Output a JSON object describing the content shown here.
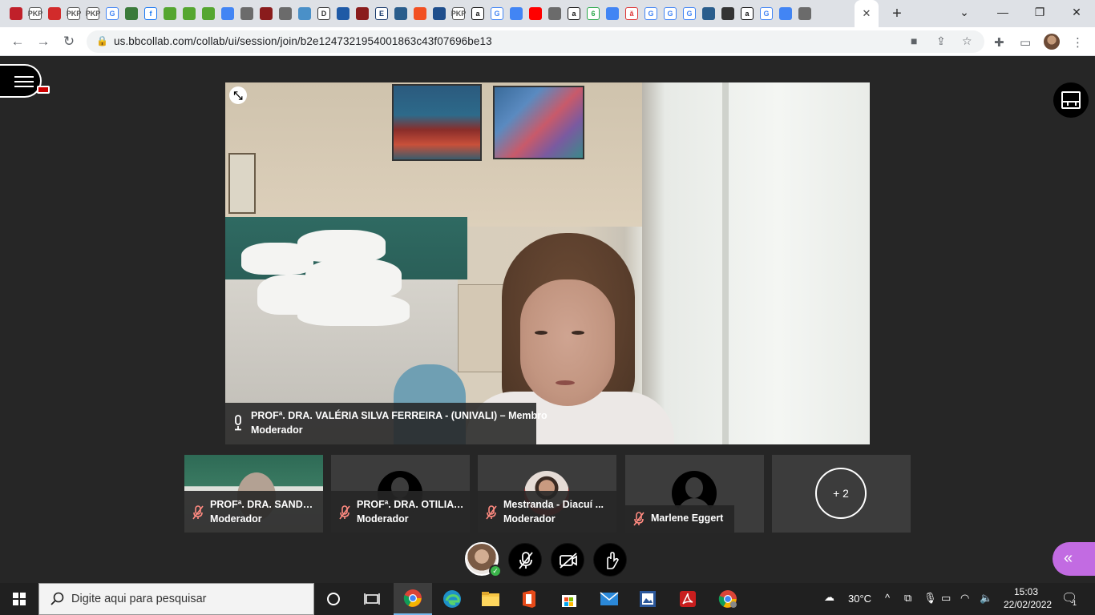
{
  "browser": {
    "url": "us.bbcollab.com/collab/ui/session/join/b2e1247321954001863c43f07696be13",
    "tab_icons": [
      {
        "name": "tab-icon-red-circle",
        "label": "",
        "color": "#c0202a"
      },
      {
        "name": "tab-icon-pkp",
        "label": "PKP",
        "color": "#555555"
      },
      {
        "name": "tab-icon-red-square",
        "label": "",
        "color": "#d22b2b"
      },
      {
        "name": "tab-icon-pkp",
        "label": "PKP",
        "color": "#555555"
      },
      {
        "name": "tab-icon-pkp",
        "label": "PKP",
        "color": "#555555"
      },
      {
        "name": "tab-icon-google",
        "label": "G",
        "color": "#4285f4"
      },
      {
        "name": "tab-icon-green-leaf",
        "label": "",
        "color": "#3a7a3a"
      },
      {
        "name": "tab-icon-facebook",
        "label": "f",
        "color": "#1877f2"
      },
      {
        "name": "tab-icon-search-green",
        "label": "",
        "color": "#55a630"
      },
      {
        "name": "tab-icon-search-green",
        "label": "",
        "color": "#55a630"
      },
      {
        "name": "tab-icon-search-green",
        "label": "",
        "color": "#55a630"
      },
      {
        "name": "tab-icon-docs",
        "label": "",
        "color": "#4285f4"
      },
      {
        "name": "tab-icon-globe",
        "label": "",
        "color": "#6b6b6b"
      },
      {
        "name": "tab-icon-pen",
        "label": "",
        "color": "#8a1c1c"
      },
      {
        "name": "tab-icon-globe",
        "label": "",
        "color": "#6b6b6b"
      },
      {
        "name": "tab-icon-asterisk",
        "label": "",
        "color": "#4a90c8"
      },
      {
        "name": "tab-icon-d",
        "label": "D",
        "color": "#333333"
      },
      {
        "name": "tab-icon-blue-mail",
        "label": "",
        "color": "#1f5aa6"
      },
      {
        "name": "tab-icon-pen",
        "label": "",
        "color": "#8a1c1c"
      },
      {
        "name": "tab-icon-e",
        "label": "E",
        "color": "#1a3a6b"
      },
      {
        "name": "tab-icon-camera",
        "label": "",
        "color": "#2a5d8c"
      },
      {
        "name": "tab-icon-microsoft",
        "label": "",
        "color": "#f25022"
      },
      {
        "name": "tab-icon-x-blue",
        "label": "",
        "color": "#1f4e8c"
      },
      {
        "name": "tab-icon-pkp",
        "label": "PKP",
        "color": "#555555"
      },
      {
        "name": "tab-icon-amazon",
        "label": "a",
        "color": "#111111"
      },
      {
        "name": "tab-icon-google",
        "label": "G",
        "color": "#4285f4"
      },
      {
        "name": "tab-icon-docs",
        "label": "",
        "color": "#4285f4"
      },
      {
        "name": "tab-icon-youtube",
        "label": "",
        "color": "#ff0000"
      },
      {
        "name": "tab-icon-globe",
        "label": "",
        "color": "#6b6b6b"
      },
      {
        "name": "tab-icon-amazon",
        "label": "a",
        "color": "#111111"
      },
      {
        "name": "tab-icon-six",
        "label": "6",
        "color": "#2aa84a"
      },
      {
        "name": "tab-icon-docs",
        "label": "",
        "color": "#4285f4"
      },
      {
        "name": "tab-icon-a-red",
        "label": "ă",
        "color": "#d33"
      },
      {
        "name": "tab-icon-google",
        "label": "G",
        "color": "#4285f4"
      },
      {
        "name": "tab-icon-google",
        "label": "G",
        "color": "#4285f4"
      },
      {
        "name": "tab-icon-google",
        "label": "G",
        "color": "#4285f4"
      },
      {
        "name": "tab-icon-camera",
        "label": "",
        "color": "#2a5d8c"
      },
      {
        "name": "tab-icon-plus-dark",
        "label": "",
        "color": "#333333"
      },
      {
        "name": "tab-icon-amazon",
        "label": "a",
        "color": "#111111"
      },
      {
        "name": "tab-icon-google",
        "label": "G",
        "color": "#4285f4"
      },
      {
        "name": "tab-icon-docs",
        "label": "",
        "color": "#4285f4"
      },
      {
        "name": "tab-icon-globe",
        "label": "",
        "color": "#6b6b6b"
      }
    ]
  },
  "session": {
    "main_speaker": {
      "name": "PROFª. DRA. VALÉRIA SILVA FERREIRA - (UNIVALI) – Membro",
      "role": "Moderador"
    },
    "participants": [
      {
        "name": "PROFª. DRA. SANDR...",
        "role": "Moderador"
      },
      {
        "name": "PROFª. DRA. OTILIA ...",
        "role": "Moderador"
      },
      {
        "name": "Mestranda - Diacuí ...",
        "role": "Moderador"
      },
      {
        "name": "Marlene Eggert",
        "role": ""
      }
    ],
    "more_count": "+ 2"
  },
  "taskbar": {
    "search_placeholder": "Digite aqui para pesquisar",
    "weather": "30°C",
    "time": "15:03",
    "date": "22/02/2022",
    "notifications": "1"
  },
  "colors": {
    "session_bg": "#262626",
    "tile_bg": "#3c3c3c",
    "mute_red": "#ff8a80",
    "panel_purple": "#c26be2",
    "check_green": "#3ab54a"
  }
}
